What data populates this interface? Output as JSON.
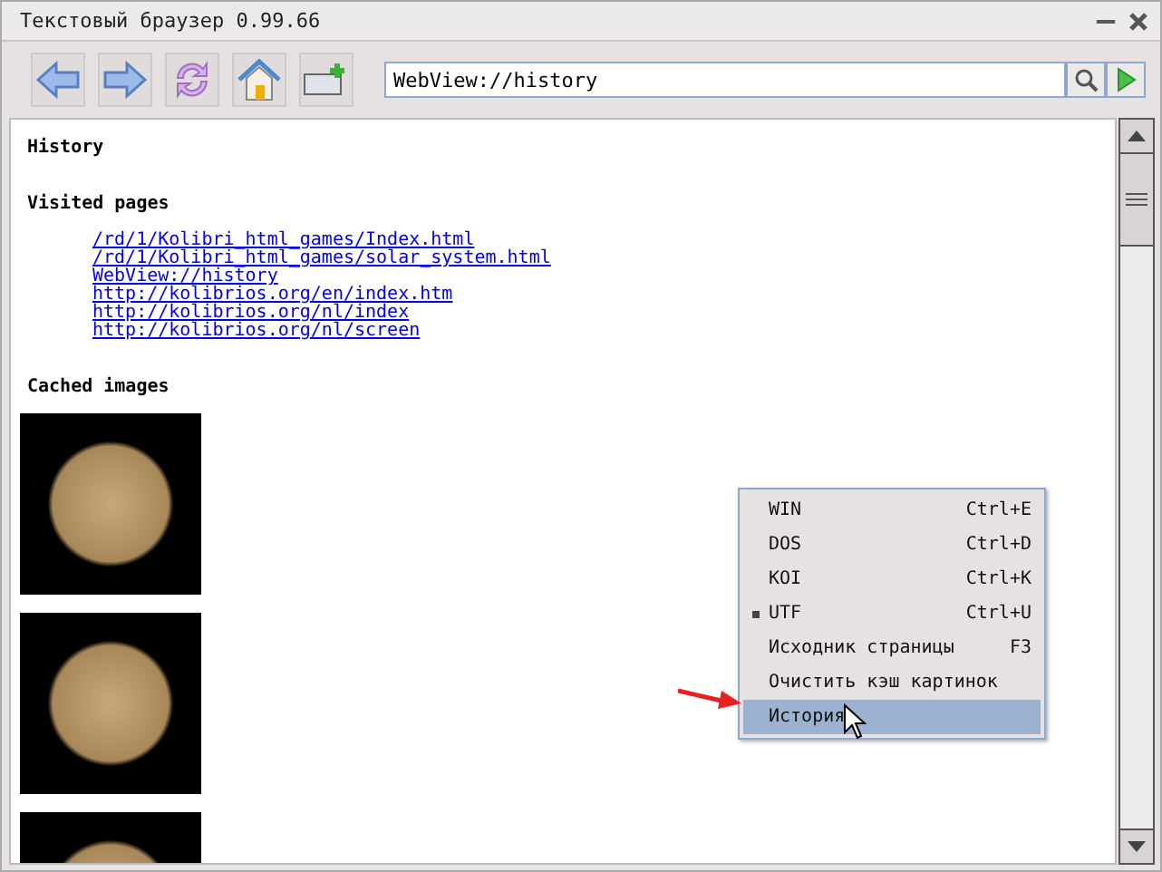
{
  "window": {
    "title": "Текстовый браузер 0.99.66"
  },
  "toolbar": {
    "address": "WebView://history"
  },
  "page": {
    "heading": "History",
    "sections": [
      {
        "title": "Visited pages",
        "links": [
          "/rd/1/Kolibri_html_games/Index.html",
          "/rd/1/Kolibri_html_games/solar_system.html",
          "WebView://history",
          "http://kolibrios.org/en/index.htm",
          "http://kolibrios.org/nl/index",
          "http://kolibrios.org/nl/screen"
        ]
      },
      {
        "title": "Cached images",
        "kind": "images"
      }
    ]
  },
  "context_menu": {
    "items": [
      {
        "label": "WIN",
        "shortcut": "Ctrl+E",
        "checked": false,
        "selected": false
      },
      {
        "label": "DOS",
        "shortcut": "Ctrl+D",
        "checked": false,
        "selected": false
      },
      {
        "label": "KOI",
        "shortcut": "Ctrl+K",
        "checked": false,
        "selected": false
      },
      {
        "label": "UTF",
        "shortcut": "Ctrl+U",
        "checked": true,
        "selected": false
      },
      {
        "label": "Исходник страницы",
        "shortcut": "F3",
        "checked": false,
        "selected": false
      },
      {
        "label": "Очистить кэш картинок",
        "checked": false,
        "selected": false
      },
      {
        "label": "История",
        "checked": false,
        "selected": true
      }
    ]
  }
}
